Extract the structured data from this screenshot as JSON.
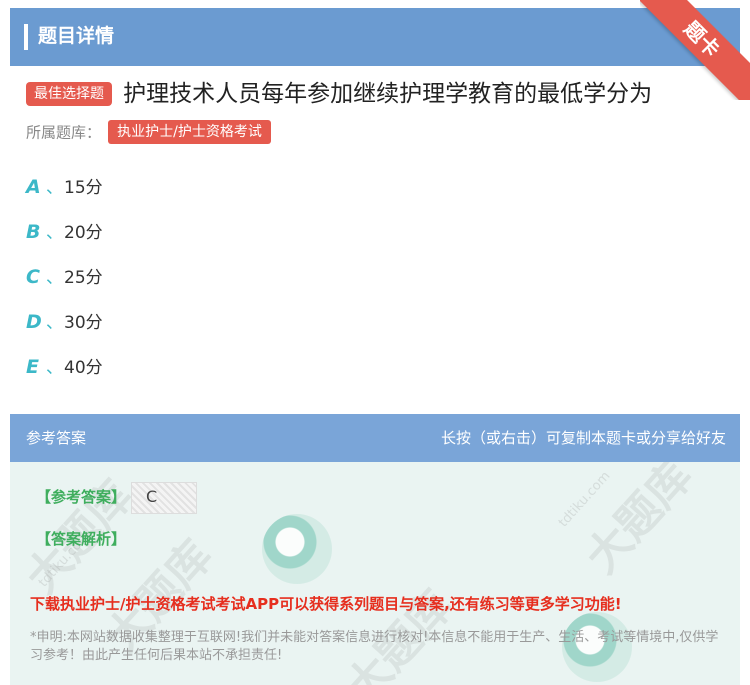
{
  "header": {
    "title": "题目详情",
    "corner_ribbon": "题卡"
  },
  "question": {
    "type_badge": "最佳选择题",
    "text": "护理技术人员每年参加继续护理学教育的最低学分为",
    "bank_label": "所属题库：",
    "bank_name": "执业护士/护士资格考试"
  },
  "options": [
    {
      "letter": "A",
      "sep": "、",
      "text": "15分"
    },
    {
      "letter": "B",
      "sep": "、",
      "text": "20分"
    },
    {
      "letter": "C",
      "sep": "、",
      "text": "25分"
    },
    {
      "letter": "D",
      "sep": "、",
      "text": "30分"
    },
    {
      "letter": "E",
      "sep": "、",
      "text": "40分"
    }
  ],
  "answer_section": {
    "header_left": "参考答案",
    "header_right": "长按（或右击）可复制本题卡或分享给好友",
    "answer_key_label": "【参考答案】",
    "answer_value": "C",
    "analysis_label": "【答案解析】",
    "promo_text": "下载执业护士/护士资格考试考试APP可以获得系列题目与答案,还有练习等更多学习功能!",
    "disclaimer": "*申明:本网站数据收集整理于互联网!我们并未能对答案信息进行核对!本信息不能用于生产、生活、考试等情境中,仅供学习参考！由此产生任何后果本站不承担责任!"
  },
  "watermark": {
    "text": "大题库",
    "url": "tdtiku.com"
  },
  "colors": {
    "header_blue": "#6b9bd1",
    "badge_red": "#e55a4e",
    "option_teal": "#3cb8c8",
    "answer_green": "#3fae5e",
    "promo_red": "#e62e1e"
  }
}
